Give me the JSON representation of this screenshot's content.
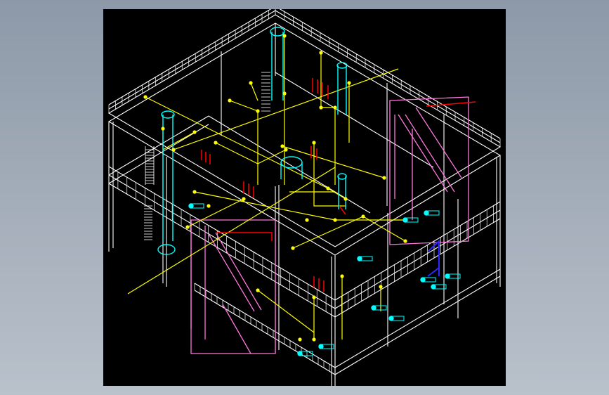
{
  "drawing": {
    "background": "#000000",
    "outer_background": "#9aa5b2",
    "colors": {
      "frame": "#ffffff",
      "piping": "#ffff00",
      "equipment": "#00ffff",
      "stairs": "#ff77dd",
      "valves": "#ff0000",
      "highlight": "#0000ff"
    }
  }
}
